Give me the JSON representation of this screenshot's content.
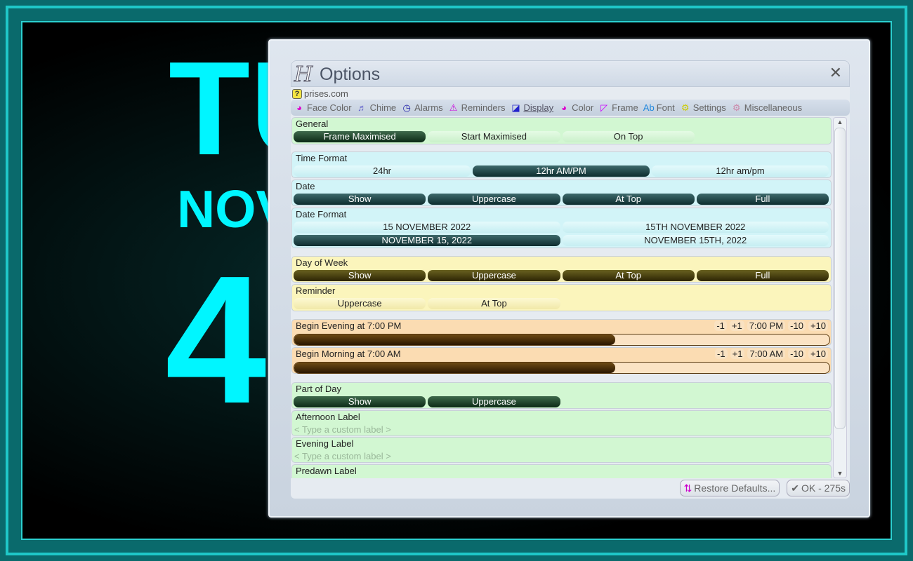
{
  "background": {
    "day": "TU",
    "month": "NOV",
    "time": "4"
  },
  "dialog": {
    "title": "Options",
    "url": "prises.com",
    "close": "✕"
  },
  "tabs": [
    {
      "label": "Face Color",
      "icon": "color-wheel-icon",
      "glyph": "◕",
      "color": "#d0c"
    },
    {
      "label": "Chime",
      "icon": "music-icon",
      "glyph": "♬",
      "color": "#66c"
    },
    {
      "label": "Alarms",
      "icon": "clock-icon",
      "glyph": "◷",
      "color": "#22a"
    },
    {
      "label": "Reminders",
      "icon": "warning-icon",
      "glyph": "⚠",
      "color": "#c0d"
    },
    {
      "label": "Display",
      "icon": "monitor-icon",
      "glyph": "◪",
      "color": "#22c",
      "active": true
    },
    {
      "label": "Color",
      "icon": "color-wheel-icon",
      "glyph": "◕",
      "color": "#d0c"
    },
    {
      "label": "Frame",
      "icon": "frame-icon",
      "glyph": "◸",
      "color": "#c0f"
    },
    {
      "label": "Font",
      "icon": "font-icon",
      "glyph": "Ab",
      "color": "#28d"
    },
    {
      "label": "Settings",
      "icon": "gear-icon",
      "glyph": "⚙",
      "color": "#cc0"
    },
    {
      "label": "Miscellaneous",
      "icon": "misc-gear-icon",
      "glyph": "⚙",
      "color": "#c8a"
    }
  ],
  "sections": [
    {
      "label": "General",
      "theme": "green",
      "buttons": [
        {
          "label": "Frame Maximised",
          "on": true
        },
        {
          "label": "Start Maximised",
          "on": false
        },
        {
          "label": "On Top",
          "on": false
        }
      ],
      "cols": 4
    },
    {
      "label": "Time Format",
      "theme": "cyan",
      "buttons": [
        {
          "label": "24hr",
          "on": false
        },
        {
          "label": "12hr AM/PM",
          "on": true
        },
        {
          "label": "12hr am/pm",
          "on": false
        }
      ],
      "cols": 3
    },
    {
      "label": "Date",
      "theme": "cyan",
      "buttons": [
        {
          "label": "Show",
          "on": true
        },
        {
          "label": "Uppercase",
          "on": true
        },
        {
          "label": "At Top",
          "on": true
        },
        {
          "label": "Full",
          "on": true
        }
      ],
      "cols": 4
    },
    {
      "label": "Date Format",
      "theme": "cyan",
      "buttons": [
        {
          "label": "15 NOVEMBER 2022",
          "on": false
        },
        {
          "label": "15TH NOVEMBER 2022",
          "on": false
        },
        {
          "label": "NOVEMBER 15, 2022",
          "on": true
        },
        {
          "label": "NOVEMBER 15TH, 2022",
          "on": false
        }
      ],
      "cols": 2
    },
    {
      "label": "Day of Week",
      "theme": "yellow",
      "buttons": [
        {
          "label": "Show",
          "on": true
        },
        {
          "label": "Uppercase",
          "on": true
        },
        {
          "label": "At Top",
          "on": true
        },
        {
          "label": "Full",
          "on": true
        }
      ],
      "cols": 4
    },
    {
      "label": "Reminder",
      "theme": "yellow",
      "buttons": [
        {
          "label": "Uppercase",
          "on": false
        },
        {
          "label": "At Top",
          "on": false
        }
      ],
      "cols": 4
    },
    {
      "label": "Begin Evening at 7:00 PM",
      "theme": "orange",
      "slider": {
        "value": 0.6,
        "steps": [
          "-1",
          "+1",
          "7:00 PM",
          "-10",
          "+10"
        ]
      }
    },
    {
      "label": "Begin Morning at 7:00 AM",
      "theme": "orange",
      "slider": {
        "value": 0.6,
        "steps": [
          "-1",
          "+1",
          "7:00 AM",
          "-10",
          "+10"
        ]
      }
    },
    {
      "label": "Part of Day",
      "theme": "green",
      "buttons": [
        {
          "label": "Show",
          "on": true
        },
        {
          "label": "Uppercase",
          "on": true
        }
      ],
      "cols": 4
    },
    {
      "label": "Afternoon Label",
      "theme": "green",
      "placeholder": "< Type a custom label >"
    },
    {
      "label": "Evening Label",
      "theme": "green",
      "placeholder": "< Type a custom label >"
    },
    {
      "label": "Predawn Label",
      "theme": "green"
    }
  ],
  "footer": {
    "restore": "Restore Defaults...",
    "ok": "OK - 275s"
  }
}
